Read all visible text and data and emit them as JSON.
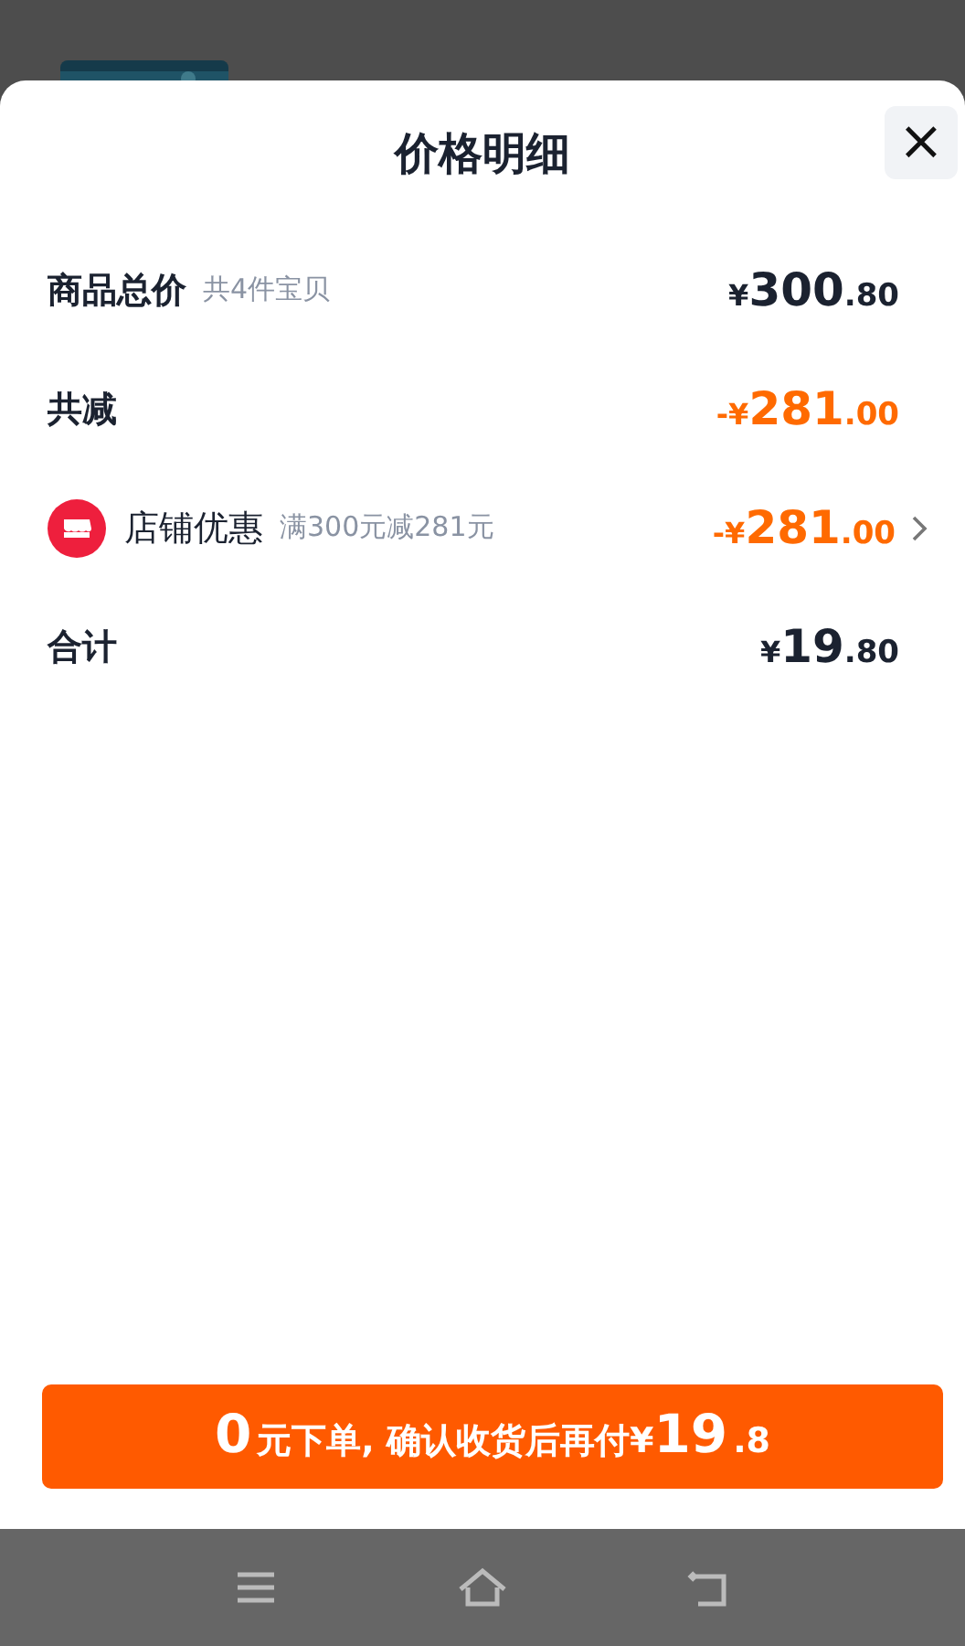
{
  "sheet": {
    "title": "价格明细",
    "close": "×"
  },
  "rows": [
    {
      "kind": "line",
      "label": "商品总价",
      "note": "共4件宝贝",
      "color": "#1b2230",
      "price": {
        "currency": "¥",
        "integer": "300",
        "decimal": ".80"
      }
    },
    {
      "kind": "line",
      "label": "共减",
      "color": "#ff6a00",
      "price": {
        "sign": "-",
        "currency": "¥",
        "integer": "281",
        "decimal": ".00"
      }
    },
    {
      "kind": "discount",
      "label": "店铺优惠",
      "note": "满300元减281元",
      "color": "#ff6a00",
      "price": {
        "sign": "-",
        "currency": "¥",
        "integer": "281",
        "decimal": ".00"
      }
    },
    {
      "kind": "line",
      "label": "合计",
      "color": "#1b2230",
      "price": {
        "currency": "¥",
        "integer": "19",
        "decimal": ".80"
      }
    }
  ],
  "action_button": [
    {
      "kind": "big",
      "text": "0"
    },
    {
      "kind": "small",
      "text": "元下单, 确认收货后再付¥"
    },
    {
      "kind": "big",
      "text": "19"
    },
    {
      "kind": "small",
      "text": ".8"
    }
  ]
}
